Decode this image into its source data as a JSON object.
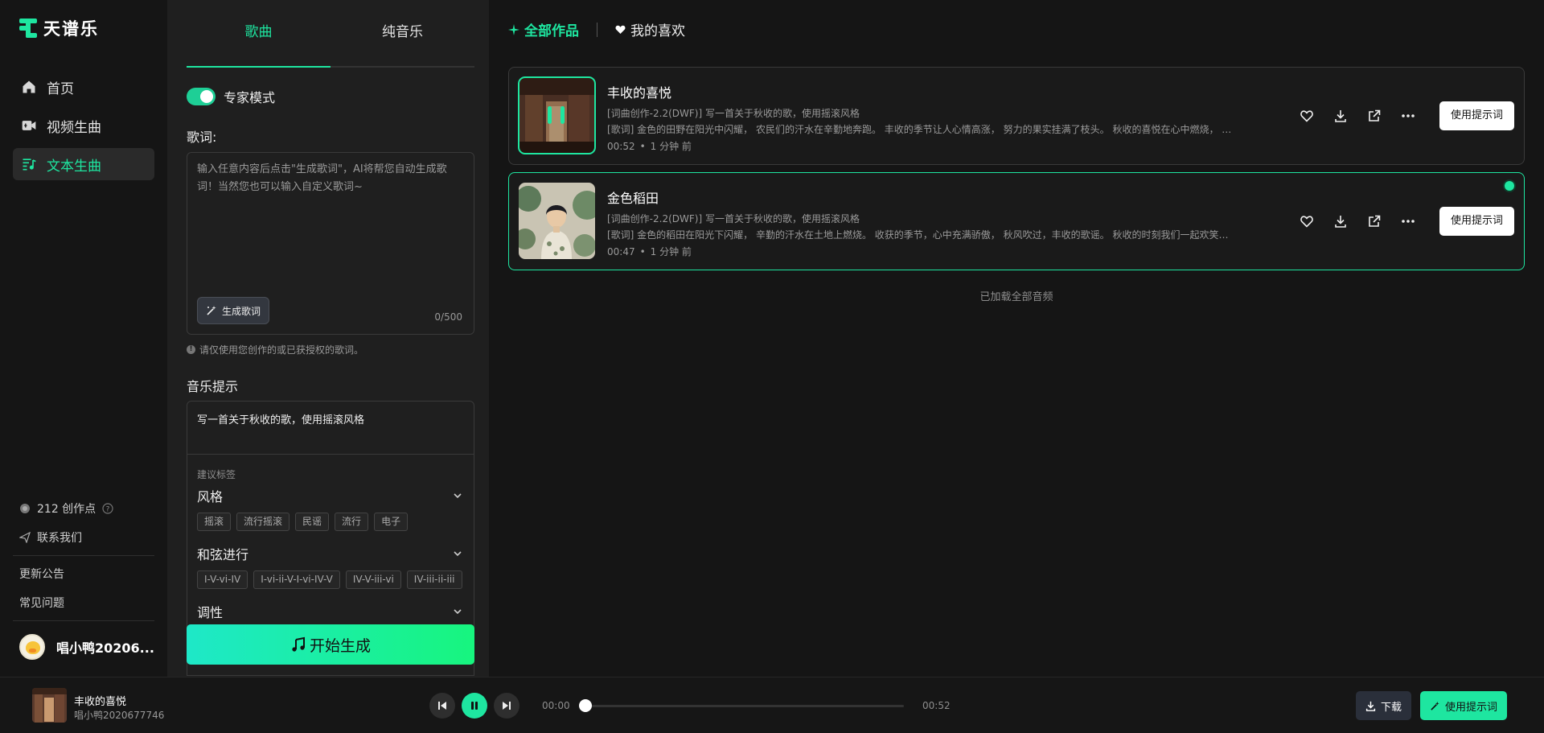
{
  "app": {
    "name": "天谱乐",
    "accent": "#1ee6a0"
  },
  "sidebar": {
    "nav": [
      {
        "label": "首页",
        "icon": "home-icon"
      },
      {
        "label": "视频生曲",
        "icon": "video-icon"
      },
      {
        "label": "文本生曲",
        "icon": "text-music-icon"
      }
    ],
    "credits": "212 创作点",
    "contact": "联系我们",
    "announcements": "更新公告",
    "faq": "常见问题",
    "username": "唱小鸭20206..."
  },
  "panel": {
    "tabs": [
      "歌曲",
      "纯音乐"
    ],
    "expert_mode": "专家模式",
    "lyrics_label": "歌词:",
    "lyrics_placeholder": "输入任意内容后点击\"生成歌词\"，AI将帮您自动生成歌词！当然您也可以输入自定义歌词~",
    "generate_lyrics": "生成歌词",
    "counter": "0/500",
    "notice": "请仅使用您创作的或已获授权的歌词。",
    "prompt_label": "音乐提示",
    "prompt_text": "写一首关于秋收的歌，使用摇滚风格",
    "suggest_title": "建议标签",
    "groups": [
      {
        "title": "风格",
        "tags": [
          "摇滚",
          "流行摇滚",
          "民谣",
          "流行",
          "电子"
        ]
      },
      {
        "title": "和弦进行",
        "tags": [
          "I-V-vi-IV",
          "I-vi-ii-V-I-vi-IV-V",
          "IV-V-iii-vi",
          "IV-iii-ii-iii"
        ]
      },
      {
        "title": "调性",
        "tags": []
      }
    ],
    "start_button": "开始生成"
  },
  "main": {
    "tabs": [
      {
        "label": "全部作品",
        "icon": "sparkle-icon"
      },
      {
        "label": "我的喜欢",
        "icon": "heart-icon"
      }
    ],
    "songs": [
      {
        "title": "丰收的喜悦",
        "desc": "[词曲创作-2.2(DWF)] 写一首关于秋收的歌，使用摇滚风格",
        "lyrics": "[歌词] 金色的田野在阳光中闪耀， 农民们的汗水在辛勤地奔跑。 丰收的季节让人心情高涨， 努力的果实挂满了枝头。 秋收的喜悦在心中燃烧， 丰...",
        "duration": "00:52",
        "ago": "1 分钟 前",
        "use_prompt": "使用提示词"
      },
      {
        "title": "金色稻田",
        "desc": "[词曲创作-2.2(DWF)] 写一首关于秋收的歌，使用摇滚风格",
        "lyrics": "[歌词] 金色的稻田在阳光下闪耀， 辛勤的汗水在土地上燃烧。 收获的季节，心中充满骄傲， 秋风吹过，丰收的歌谣。 秋收的时刻我们一起欢笑， ...",
        "duration": "00:47",
        "ago": "1 分钟 前",
        "use_prompt": "使用提示词"
      }
    ],
    "loaded_all": "已加载全部音频"
  },
  "player": {
    "title": "丰收的喜悦",
    "artist": "唱小鸭2020677746",
    "current": "00:00",
    "total": "00:52",
    "progress": 0,
    "download": "下载",
    "use_prompt": "使用提示词"
  }
}
